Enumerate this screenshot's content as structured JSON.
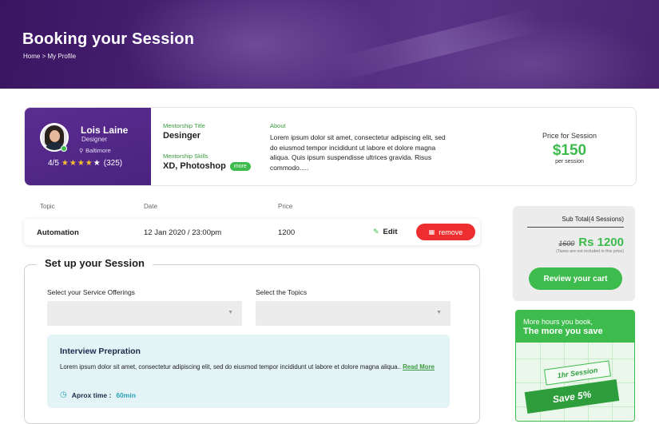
{
  "hero": {
    "title": "Booking your Session",
    "breadcrumb_home": "Home",
    "breadcrumb_sep": ">",
    "breadcrumb_current": "My Profile"
  },
  "mentor": {
    "name": "Lois Laine",
    "role": "Designer",
    "location": "Baltimore",
    "rating": "4/5",
    "stars": 5,
    "review_count": "(325)",
    "title_label": "Mentorship Title",
    "title_value": "Desinger",
    "skills_label": "Mentorship Skills",
    "skills_value": "XD, Photoshop",
    "more_label": "more",
    "about_label": "About",
    "about_text": "Lorem ipsum dolor sit amet, consectetur adipiscing elit, sed do eiusmod tempor incididunt ut labore et dolore magna aliqua. Quis ipsum suspendisse ultrices gravida. Risus commodo.....",
    "price_label": "Price for Session",
    "price_value": "$150",
    "price_unit": "per session"
  },
  "table": {
    "headers": [
      "Topic",
      "Date",
      "Price"
    ],
    "rows": [
      {
        "topic": "Automation",
        "date": "12 Jan 2020 / 23:00pm",
        "price": "1200",
        "edit": "Edit",
        "remove": "remove"
      }
    ]
  },
  "setup": {
    "title": "Set up your Session",
    "offerings_label": "Select your Service Offerings",
    "offerings_value": "",
    "topics_label": "Select the Topics",
    "topics_value": "",
    "interview_title": "Interview Prepration",
    "interview_text": "Lorem ipsum dolor sit amet, consectetur adipiscing elit, sed do eiusmod tempor incididunt ut labore et dolore magna aliqua..",
    "read_more": "Read More",
    "time_label": "Aprox time :",
    "time_value": "60min"
  },
  "summary": {
    "sub_total": "Sub Total(4 Sessions)",
    "old_price": "1600",
    "new_price": "Rs 1200",
    "tax_note": "(Taxes are not included in this price)",
    "review_button": "Review your cart"
  },
  "promo": {
    "line1": "More hours you book,",
    "line2": "The more you save",
    "ribbon1": "1hr Session",
    "ribbon2": "Save 5%"
  },
  "colors": {
    "brand_purple": "#4a2280",
    "accent_green": "#3dbb4c",
    "remove_red": "#ee2e2e",
    "info_teal": "#2aa3b5"
  }
}
